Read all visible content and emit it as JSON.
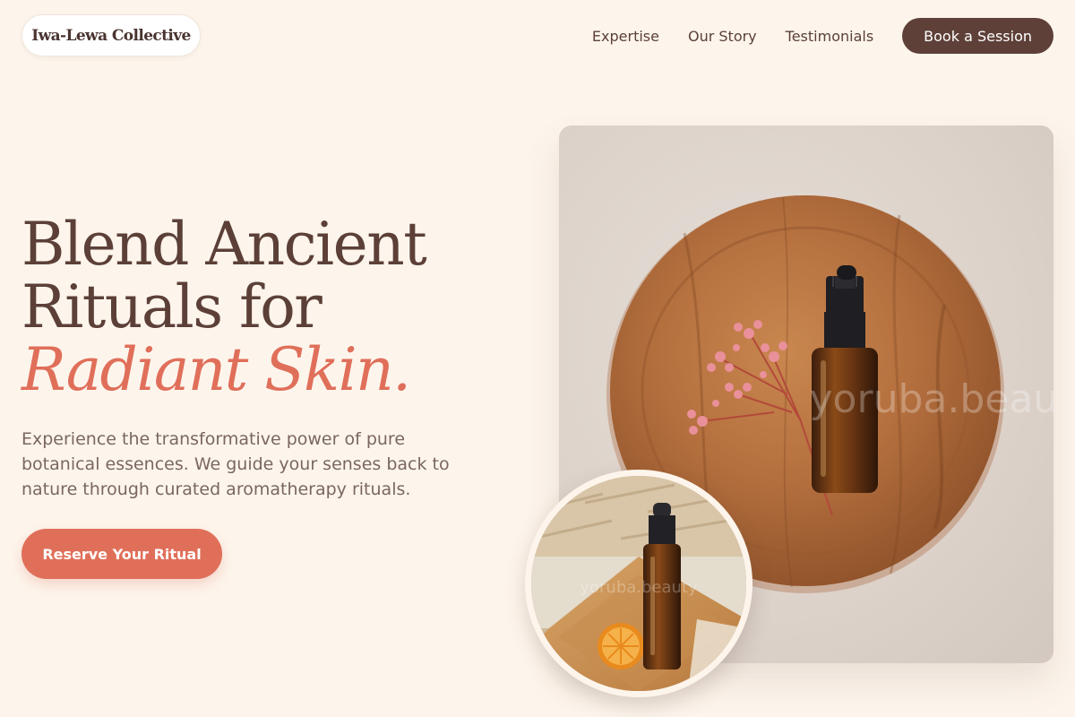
{
  "header": {
    "logo": "Iwa-Lewa Collective",
    "nav": [
      {
        "label": "Expertise"
      },
      {
        "label": "Our Story"
      },
      {
        "label": "Testimonials"
      }
    ],
    "cta_label": "Book a Session"
  },
  "hero": {
    "title_line1": "Blend Ancient",
    "title_line2": "Rituals for",
    "title_accent": "Radiant Skin.",
    "description": "Experience the transformative power of pure botanical essences. We guide your senses back to nature through curated aromatherapy rituals.",
    "cta_label": "Reserve Your Ritual"
  },
  "images": {
    "main_watermark": "yoruba.beauty",
    "inset_watermark": "yoruba.beauty"
  },
  "colors": {
    "background": "#fdf5ec",
    "primary_brown": "#5e4039",
    "accent_coral": "#e06f5a"
  }
}
